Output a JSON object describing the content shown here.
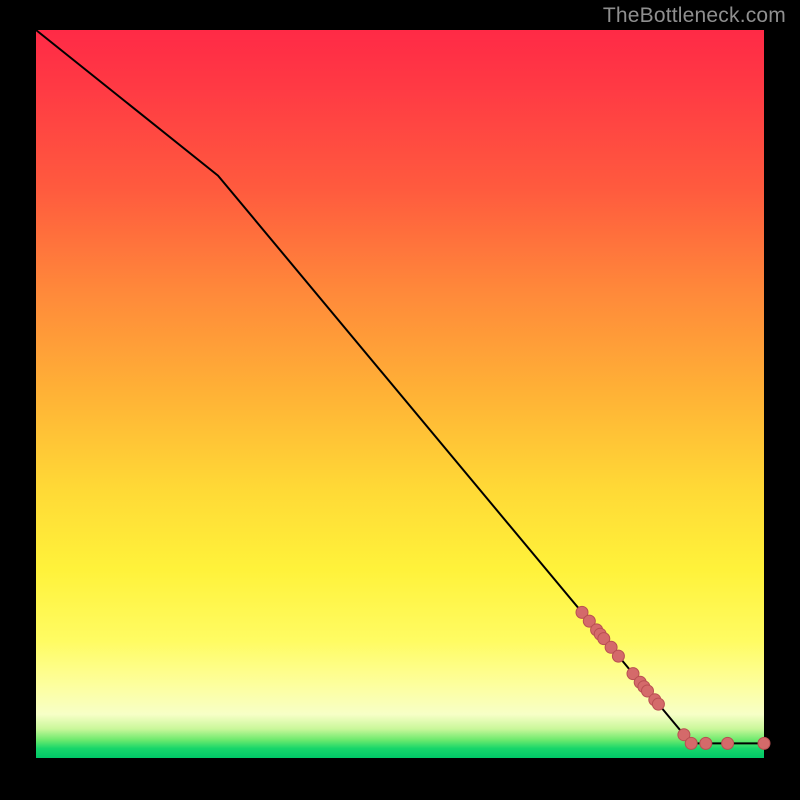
{
  "attribution": "TheBottleneck.com",
  "colors": {
    "frame_bg": "#000000",
    "dot_fill": "#d46a6a",
    "dot_stroke": "#b94f52",
    "curve": "#000000"
  },
  "chart_data": {
    "type": "line",
    "title": "",
    "xlabel": "",
    "ylabel": "",
    "xlim": [
      0,
      100
    ],
    "ylim": [
      0,
      100
    ],
    "grid": false,
    "curve_xy": [
      {
        "x": 0,
        "y": 100
      },
      {
        "x": 25,
        "y": 80
      },
      {
        "x": 90,
        "y": 2
      },
      {
        "x": 100,
        "y": 2
      }
    ],
    "points_xy": [
      {
        "x": 75,
        "y": 20.0
      },
      {
        "x": 76,
        "y": 18.8
      },
      {
        "x": 77,
        "y": 17.6
      },
      {
        "x": 77.5,
        "y": 17.0
      },
      {
        "x": 78,
        "y": 16.4
      },
      {
        "x": 79,
        "y": 15.2
      },
      {
        "x": 80,
        "y": 14.0
      },
      {
        "x": 82,
        "y": 11.6
      },
      {
        "x": 83,
        "y": 10.4
      },
      {
        "x": 83.5,
        "y": 9.8
      },
      {
        "x": 84,
        "y": 9.2
      },
      {
        "x": 85,
        "y": 8.0
      },
      {
        "x": 85.5,
        "y": 7.4
      },
      {
        "x": 89,
        "y": 3.2
      },
      {
        "x": 90,
        "y": 2.0
      },
      {
        "x": 92,
        "y": 2.0
      },
      {
        "x": 95,
        "y": 2.0
      },
      {
        "x": 100,
        "y": 2.0
      }
    ],
    "gradient_stops": [
      {
        "pos": 0,
        "color": "#ff2a46"
      },
      {
        "pos": 0.5,
        "color": "#ffd936"
      },
      {
        "pos": 0.9,
        "color": "#fdff9e"
      },
      {
        "pos": 1.0,
        "color": "#00c868"
      }
    ]
  }
}
